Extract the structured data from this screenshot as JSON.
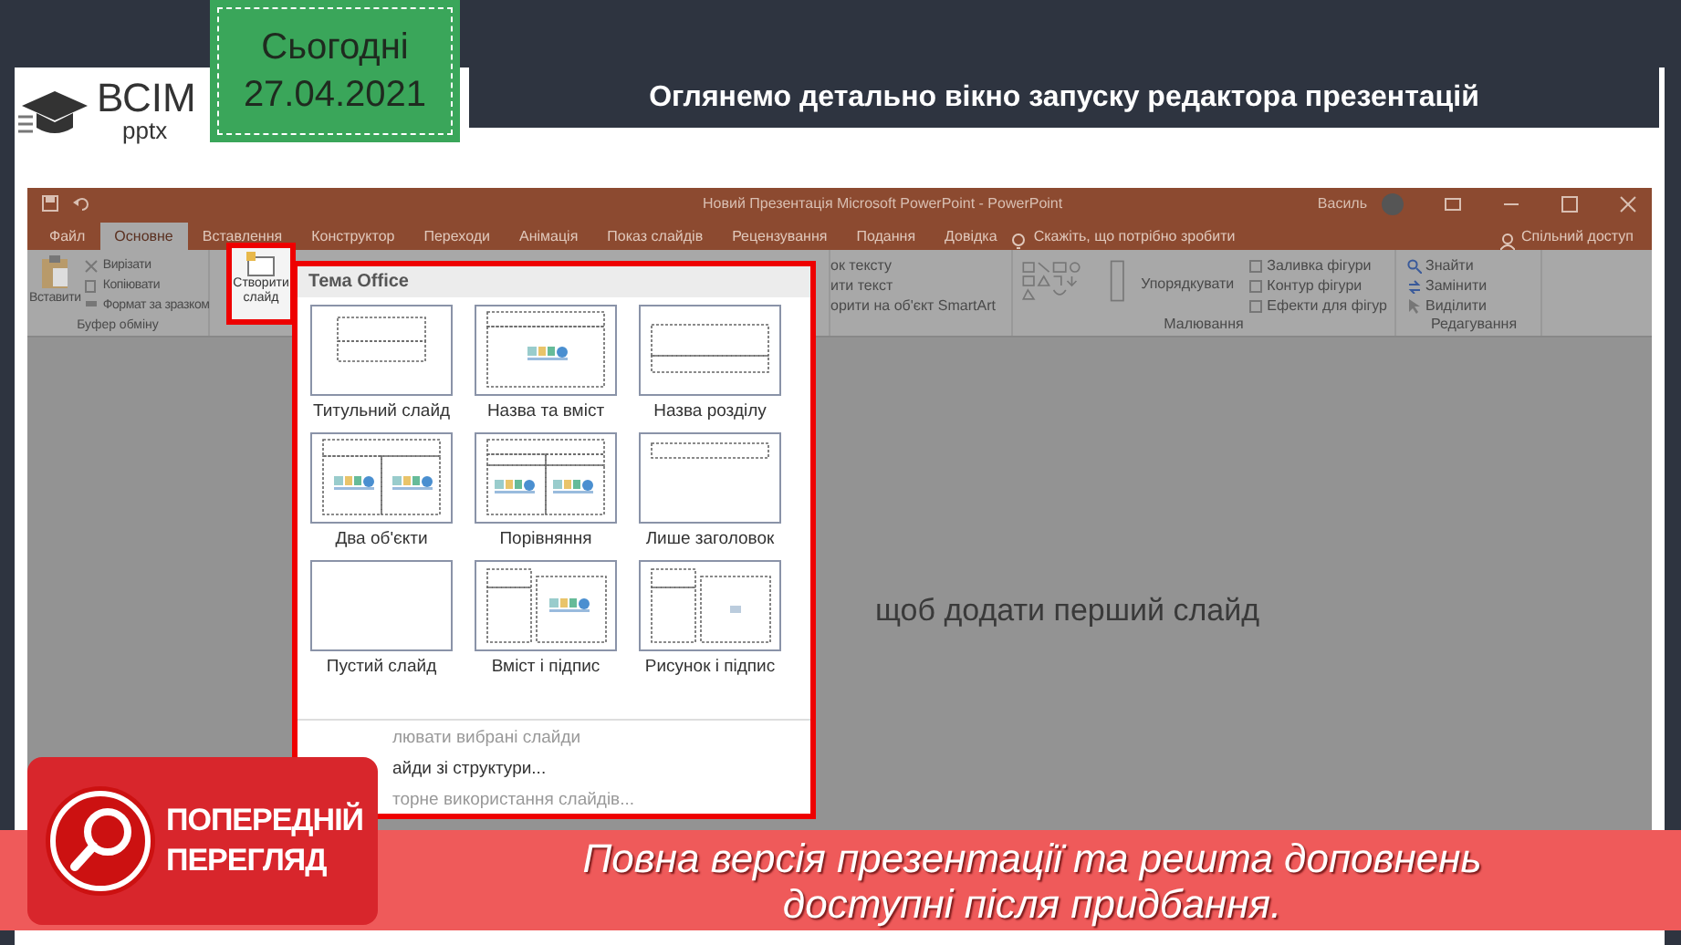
{
  "header": {
    "logo": {
      "brand": "ВСІМ",
      "sub": "pptx"
    },
    "date_card": {
      "label": "Сьогодні",
      "date": "27.04.2021"
    },
    "title": "Оглянемо детально вікно запуску редактора презентацій"
  },
  "window": {
    "title": "Новий Презентація Microsoft PowerPoint - PowerPoint",
    "user": "Василь",
    "tabs": [
      {
        "label": "Файл",
        "selected": false
      },
      {
        "label": "Основне",
        "selected": true
      },
      {
        "label": "Вставлення",
        "selected": false
      },
      {
        "label": "Конструктор",
        "selected": false
      },
      {
        "label": "Переходи",
        "selected": false
      },
      {
        "label": "Анімація",
        "selected": false
      },
      {
        "label": "Показ слайдів",
        "selected": false
      },
      {
        "label": "Рецензування",
        "selected": false
      },
      {
        "label": "Подання",
        "selected": false
      },
      {
        "label": "Довідка",
        "selected": false
      }
    ],
    "tell_me": "Скажіть, що потрібно зробити",
    "share": "Спільний доступ",
    "ribbon": {
      "clipboard": {
        "paste": "Вставити",
        "items": [
          "Вирізати",
          "Копіювати",
          "Формат за зразком"
        ],
        "label": "Буфер обміну"
      },
      "new_slide": "Створити слайд",
      "paragraph_items": [
        "ок тексту",
        "ити текст",
        "орити на об'єкт SmartArt"
      ],
      "drawing": {
        "arrange": "Упорядкувати",
        "items": [
          "Заливка фігури",
          "Контур фігури",
          "Ефекти для фігур"
        ],
        "label": "Малювання"
      },
      "editing": {
        "items": [
          "Знайти",
          "Замінити",
          "Виділити"
        ],
        "label": "Редагування"
      }
    },
    "slide_placeholder": "щоб додати перший слайд",
    "gallery": {
      "heading": "Тема Office",
      "layouts": [
        {
          "label": "Титульний слайд",
          "kind": "title"
        },
        {
          "label": "Назва та вміст",
          "kind": "title-content"
        },
        {
          "label": "Назва розділу",
          "kind": "section"
        },
        {
          "label": "Два об'єкти",
          "kind": "two-content"
        },
        {
          "label": "Порівняння",
          "kind": "comparison"
        },
        {
          "label": "Лише заголовок",
          "kind": "title-only"
        },
        {
          "label": "Пустий слайд",
          "kind": "blank"
        },
        {
          "label": "Вміст і підпис",
          "kind": "content-caption"
        },
        {
          "label": "Рисунок і підпис",
          "kind": "picture-caption"
        }
      ],
      "menu": [
        {
          "label": "лювати вибрані слайди",
          "disabled": true
        },
        {
          "label": "айди зі структури...",
          "disabled": false
        },
        {
          "label": "торне використання слайдів...",
          "disabled": true
        }
      ]
    }
  },
  "banner": {
    "badge": [
      "ПОПЕРЕДНІЙ",
      "ПЕРЕГЛЯД"
    ],
    "message": [
      "Повна версія презентації та решта доповнень",
      "доступні після придбання."
    ]
  }
}
